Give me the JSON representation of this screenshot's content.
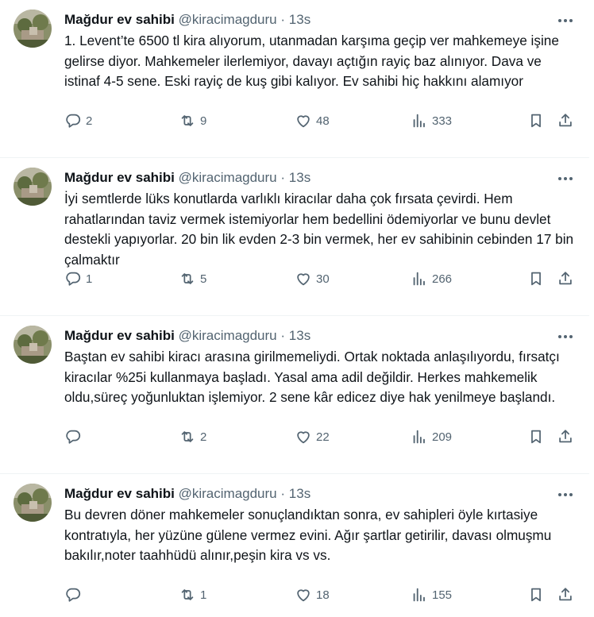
{
  "tweets": [
    {
      "author": "Mağdur ev sahibi",
      "handle": "@kiracimagduru",
      "separator": "·",
      "time": "13s",
      "text": "1. Levent’te 6500 tl kira alıyorum, utanmadan karşıma geçip ver mahkemeye işine gelirse diyor. Mahkemeler ilerlemiyor, davayı açtığın rayiç baz alınıyor. Dava ve istinaf 4-5 sene. Eski rayiç de kuş gibi kalıyor. Ev sahibi hiç hakkını alamıyor",
      "replies": "2",
      "retweets": "9",
      "likes": "48",
      "views": "333"
    },
    {
      "author": "Mağdur ev sahibi",
      "handle": "@kiracimagduru",
      "separator": "·",
      "time": "13s",
      "text": "İyi semtlerde lüks konutlarda varlıklı kiracılar daha çok fırsata çevirdi. Hem rahatlarından taviz vermek istemiyorlar hem bedellini ödemiyorlar ve bunu devlet destekli yapıyorlar. 20 bin lik evden 2-3 bin vermek, her ev sahibinin cebinden 17 bin çalmaktır",
      "replies": "1",
      "retweets": "5",
      "likes": "30",
      "views": "266"
    },
    {
      "author": "Mağdur ev sahibi",
      "handle": "@kiracimagduru",
      "separator": "·",
      "time": "13s",
      "text": "Baştan ev sahibi kiracı arasına girilmemeliydi. Ortak noktada anlaşılıyordu, fırsatçı kiracılar %25i kullanmaya başladı. Yasal ama adil değildir. Herkes mahkemelik oldu,süreç yoğunluktan işlemiyor. 2 sene kâr edicez diye hak yenilmeye başlandı.",
      "replies": "",
      "retweets": "2",
      "likes": "22",
      "views": "209"
    },
    {
      "author": "Mağdur ev sahibi",
      "handle": "@kiracimagduru",
      "separator": "·",
      "time": "13s",
      "text": "Bu devren döner mahkemeler sonuçlandıktan sonra, ev sahipleri öyle kırtasiye kontratıyla, her yüzüne gülene vermez evini. Ağır şartlar getirilir, davası olmuşmu bakılır,noter taahhüdü alınır,peşin kira vs vs.",
      "replies": "",
      "retweets": "1",
      "likes": "18",
      "views": "155"
    }
  ],
  "icons": {
    "reply": "reply-icon",
    "retweet": "retweet-icon",
    "like": "heart-icon",
    "views": "views-icon",
    "bookmark": "bookmark-icon",
    "share": "share-icon",
    "more": "more-icon"
  },
  "colors": {
    "text": "#0f1419",
    "secondary": "#536471",
    "divider": "#eff3f4"
  }
}
